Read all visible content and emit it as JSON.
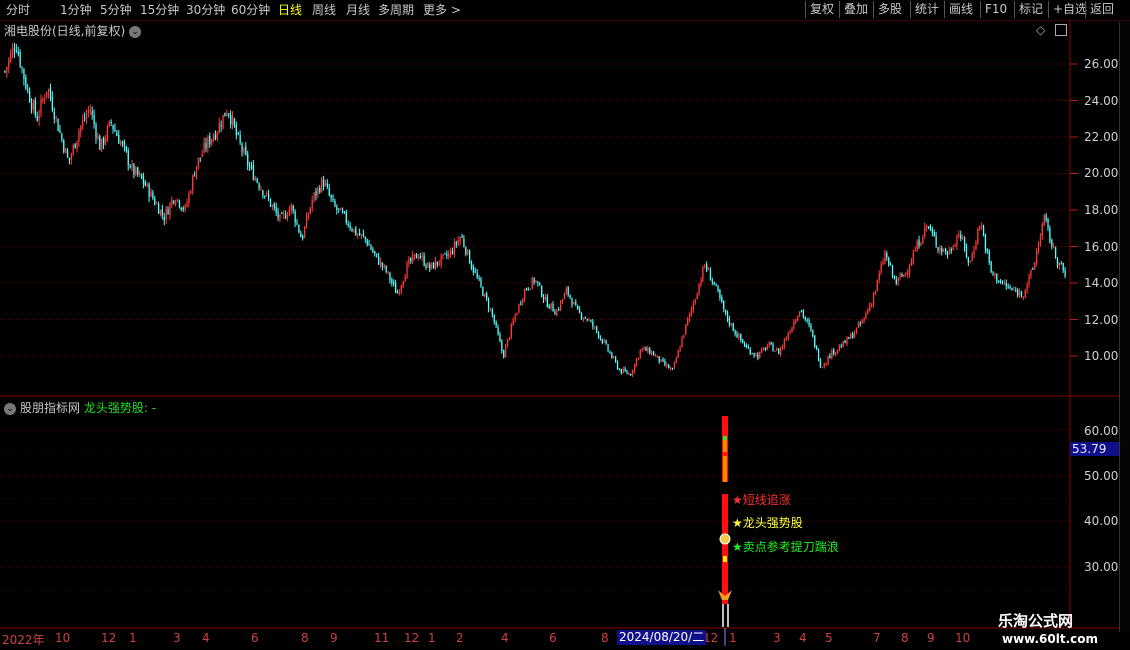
{
  "toolbar": {
    "periods": [
      "分时",
      "1分钟",
      "5分钟",
      "15分钟",
      "30分钟",
      "60分钟",
      "日线",
      "周线",
      "月线",
      "多周期",
      "更多 >"
    ],
    "active_period": "日线",
    "right_buttons": [
      "复权",
      "叠加",
      "多股",
      "统计",
      "画线",
      "F10",
      "标记",
      "+自选",
      "返回"
    ]
  },
  "main_chart": {
    "title": "湘电股份(日线,前复权)",
    "y_ticks": [
      "26.00",
      "24.00",
      "22.00",
      "20.00",
      "18.00",
      "16.00",
      "14.00",
      "12.00",
      "10.00"
    ]
  },
  "indicator": {
    "name": "股朋指标网",
    "formula": "龙头强势股: -",
    "y_ticks": [
      "60.00",
      "50.00",
      "40.00",
      "30.00"
    ],
    "current_value": "53.79",
    "annotations": [
      {
        "text": "★短线追涨",
        "color": "#ff3030"
      },
      {
        "text": "★龙头强势股",
        "color": "#ffff40"
      },
      {
        "text": "★卖点参考提刀踹浪",
        "color": "#22ee22"
      }
    ]
  },
  "x_axis": {
    "labels": [
      "2022年",
      "10",
      "12",
      "1",
      "3",
      "4",
      "6",
      "8",
      "9",
      "11",
      "12",
      "1",
      "2",
      "4",
      "6",
      "8",
      "12",
      "1",
      "3",
      "4",
      "5",
      "7",
      "8",
      "9",
      "10"
    ],
    "cursor_date": "2024/08/20/二"
  },
  "watermark": {
    "line1": "乐淘公式网",
    "line2": "www.60lt.com"
  },
  "colors": {
    "up": "#ff3b3b",
    "down": "#54ffff",
    "grid": "#7a0000",
    "active": "#ffff00"
  },
  "chart_data": {
    "type": "candlestick",
    "series": [
      {
        "values": [
          25.6,
          27.2,
          24.8,
          23.0,
          24.8,
          22.6,
          20.6,
          22.4,
          23.6,
          21.4,
          22.8,
          21.6,
          20.2,
          19.6,
          18.6,
          17.6,
          18.8,
          18.0,
          20.4,
          21.6,
          22.4,
          23.6,
          21.8,
          20.4,
          19.4,
          18.4,
          17.4,
          18.2,
          16.4,
          18.6,
          19.6,
          18.2,
          17.6,
          16.8,
          16.4,
          15.4,
          14.6,
          13.4,
          15.0,
          15.6,
          14.8,
          15.2,
          15.6,
          16.6,
          15.0,
          13.6,
          12.2,
          10.0,
          12.0,
          13.6,
          14.2,
          13.0,
          12.4,
          13.6,
          12.4,
          12.0,
          11.2,
          10.2,
          9.2,
          9.0,
          10.4,
          10.2,
          9.6,
          9.2,
          11.2,
          13.0,
          15.0,
          13.8,
          12.2,
          11.2,
          10.4,
          10.0,
          10.6,
          10.2,
          11.4,
          12.6,
          11.4,
          9.4,
          10.2,
          10.6,
          11.2,
          12.0,
          13.4,
          15.6,
          14.0,
          14.6,
          16.0,
          17.2,
          16.0,
          15.6,
          16.8,
          15.0,
          17.4,
          14.6,
          14.0,
          13.6,
          13.4,
          14.8,
          17.6,
          15.6,
          14.4
        ]
      }
    ]
  }
}
